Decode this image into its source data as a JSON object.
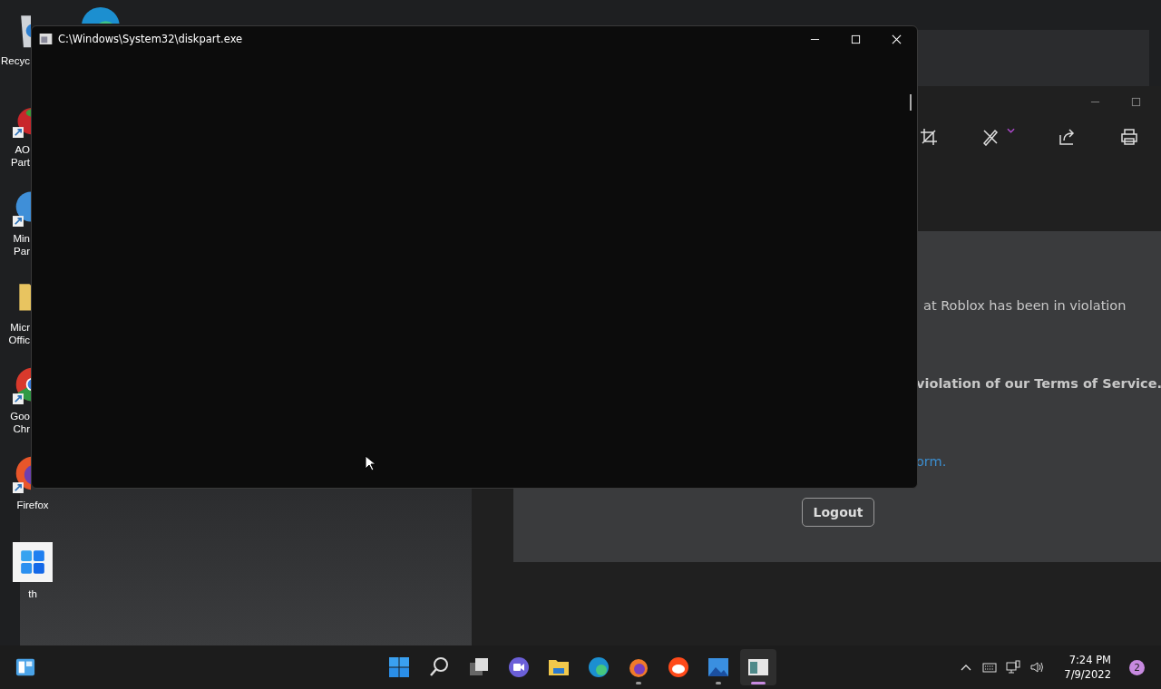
{
  "desktop_icons": [
    {
      "kind": "recycle",
      "lines": [
        "Recyc"
      ],
      "shortcut": false
    },
    {
      "kind": "red-app",
      "lines": [
        "AO",
        "Part"
      ],
      "shortcut": true
    },
    {
      "kind": "blue-app",
      "lines": [
        "Min",
        "Par"
      ],
      "shortcut": true
    },
    {
      "kind": "folder",
      "lines": [
        "Micr",
        "Offic"
      ],
      "shortcut": false
    },
    {
      "kind": "chrome",
      "lines": [
        "Goo",
        "Chr"
      ],
      "shortcut": true
    },
    {
      "kind": "firefox",
      "lines": [
        "Firefox"
      ],
      "shortcut": true
    },
    {
      "kind": "tile",
      "lines": [
        "th"
      ],
      "shortcut": false
    }
  ],
  "console": {
    "title": "C:\\Windows\\System32\\diskpart.exe"
  },
  "photos_window": {
    "content": [
      {
        "kind": "plain",
        "text": "at Roblox has been in violation"
      },
      {
        "kind": "bold",
        "text": "violation of our Terms of Service."
      },
      {
        "kind": "link",
        "text": "orm."
      }
    ],
    "button": "Logout"
  },
  "taskbar": {
    "apps": [
      {
        "kind": "start",
        "running": false,
        "selected": false
      },
      {
        "kind": "search",
        "running": false,
        "selected": false
      },
      {
        "kind": "taskview",
        "running": false,
        "selected": false
      },
      {
        "kind": "chat",
        "running": false,
        "selected": false
      },
      {
        "kind": "explorer",
        "running": false,
        "selected": false
      },
      {
        "kind": "edge",
        "running": false,
        "selected": false
      },
      {
        "kind": "firefox",
        "running": true,
        "selected": false
      },
      {
        "kind": "reddit",
        "running": false,
        "selected": false
      },
      {
        "kind": "photos",
        "running": true,
        "selected": false
      },
      {
        "kind": "console",
        "running": true,
        "selected": true
      }
    ],
    "time": "7:24 PM",
    "date": "7/9/2022",
    "notifications": "2"
  }
}
